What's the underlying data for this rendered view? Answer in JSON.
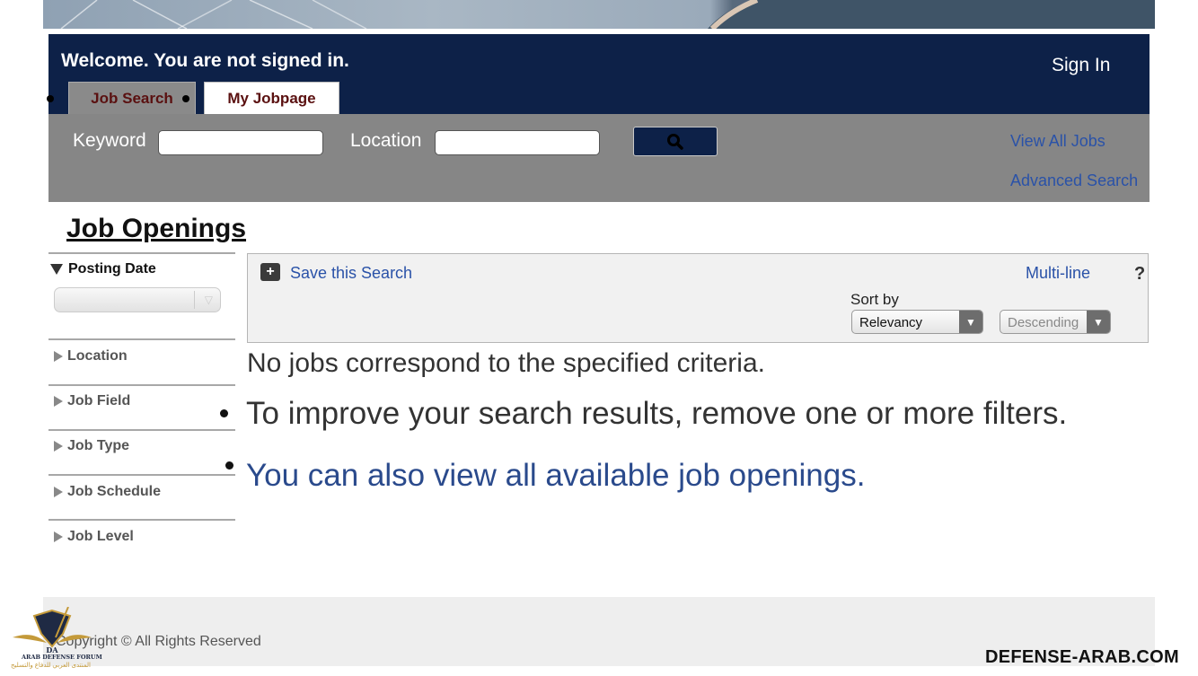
{
  "header": {
    "welcome": "Welcome. You are not signed in.",
    "sign_in": "Sign In",
    "tabs": [
      {
        "label": "Job Search",
        "active": true
      },
      {
        "label": "My Jobpage",
        "active": false
      }
    ]
  },
  "search": {
    "keyword_label": "Keyword",
    "keyword_value": "",
    "location_label": "Location",
    "location_value": "",
    "button_icon": "search-icon",
    "links": [
      "View All Jobs",
      "Advanced Search"
    ]
  },
  "page_title": "Job Openings",
  "filters": {
    "posting_date": {
      "label": "Posting Date",
      "selected": ""
    },
    "items": [
      "Location",
      "Job Field",
      "Job Type",
      "Job Schedule",
      "Job Level"
    ]
  },
  "toolbar": {
    "save_search": "Save this Search",
    "save_icon": "plus-icon",
    "multi_line": "Multi-line",
    "help_icon": "question-icon",
    "sort_by_label": "Sort by",
    "sort_by_value": "Relevancy",
    "order_value": "Descending"
  },
  "messages": {
    "no_jobs": "No jobs correspond to the specified criteria.",
    "improve": "To improve your search results, remove one or more filters.",
    "view_all": "You can also view all available job openings."
  },
  "footer": {
    "copyright": "Copyright © All Rights Reserved",
    "logo_text": "ARAB DEFENSE FORUM",
    "logo_subtext": "المنتدى العربي للدفاع والتسليح",
    "watermark": "DEFENSE-ARAB.COM"
  },
  "colors": {
    "header_bg": "#0d2148",
    "searchbar_bg": "#868686",
    "link": "#2a52a8",
    "tab_text": "#5a1010"
  }
}
